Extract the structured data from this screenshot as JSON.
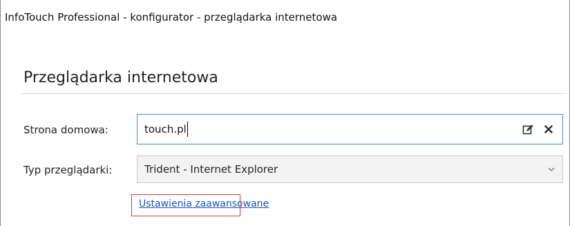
{
  "window": {
    "title": "InfoTouch Professional - konfigurator - przeglądarka internetowa"
  },
  "section": {
    "heading": "Przeglądarka internetowa"
  },
  "form": {
    "home_page": {
      "label": "Strona domowa:",
      "value": "touch.pl",
      "edit_icon": "edit-icon",
      "clear_icon": "close-icon"
    },
    "browser_type": {
      "label": "Typ przeglądarki:",
      "selected": "Trident - Internet Explorer",
      "chevron_icon": "chevron-down-icon"
    },
    "advanced_link": {
      "label": "Ustawienia zaawansowane"
    }
  },
  "colors": {
    "focus_border": "#3c8ed6",
    "link": "#1a55b4",
    "highlight_box": "#e03434",
    "select_background": "#f3f3f3"
  }
}
